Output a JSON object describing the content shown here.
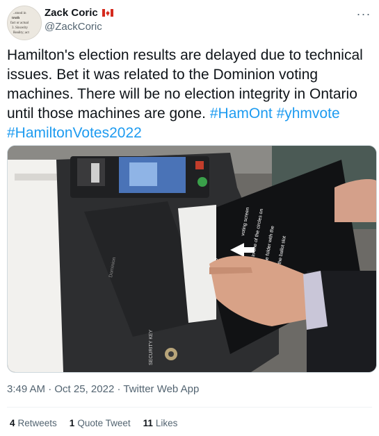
{
  "author": {
    "display_name": "Zack Coric",
    "handle": "@ZackCoric",
    "flag_icon": "canada-flag-icon"
  },
  "tweet": {
    "text_plain": "Hamilton's election results are delayed due to technical issues.  Bet it was related to the Dominion voting machines.  There will be no election integrity in Ontario until those machines are gone.",
    "hashtags": [
      "#HamOnt",
      "#yhmvote",
      "#HamiltonVotes2022"
    ]
  },
  "media": {
    "overlay_text": [
      "Top"
    ],
    "machine_label": "SECURITY KEY"
  },
  "meta": {
    "time": "3:49 AM",
    "date": "Oct 25, 2022",
    "source": "Twitter Web App",
    "separator": " · "
  },
  "stats": {
    "retweets_count": "4",
    "retweets_label": "Retweets",
    "quotes_count": "1",
    "quotes_label": "Quote Tweet",
    "likes_count": "11",
    "likes_label": "Likes"
  },
  "colors": {
    "link": "#1d9bf0",
    "text": "#0f1419",
    "muted": "#536471"
  }
}
